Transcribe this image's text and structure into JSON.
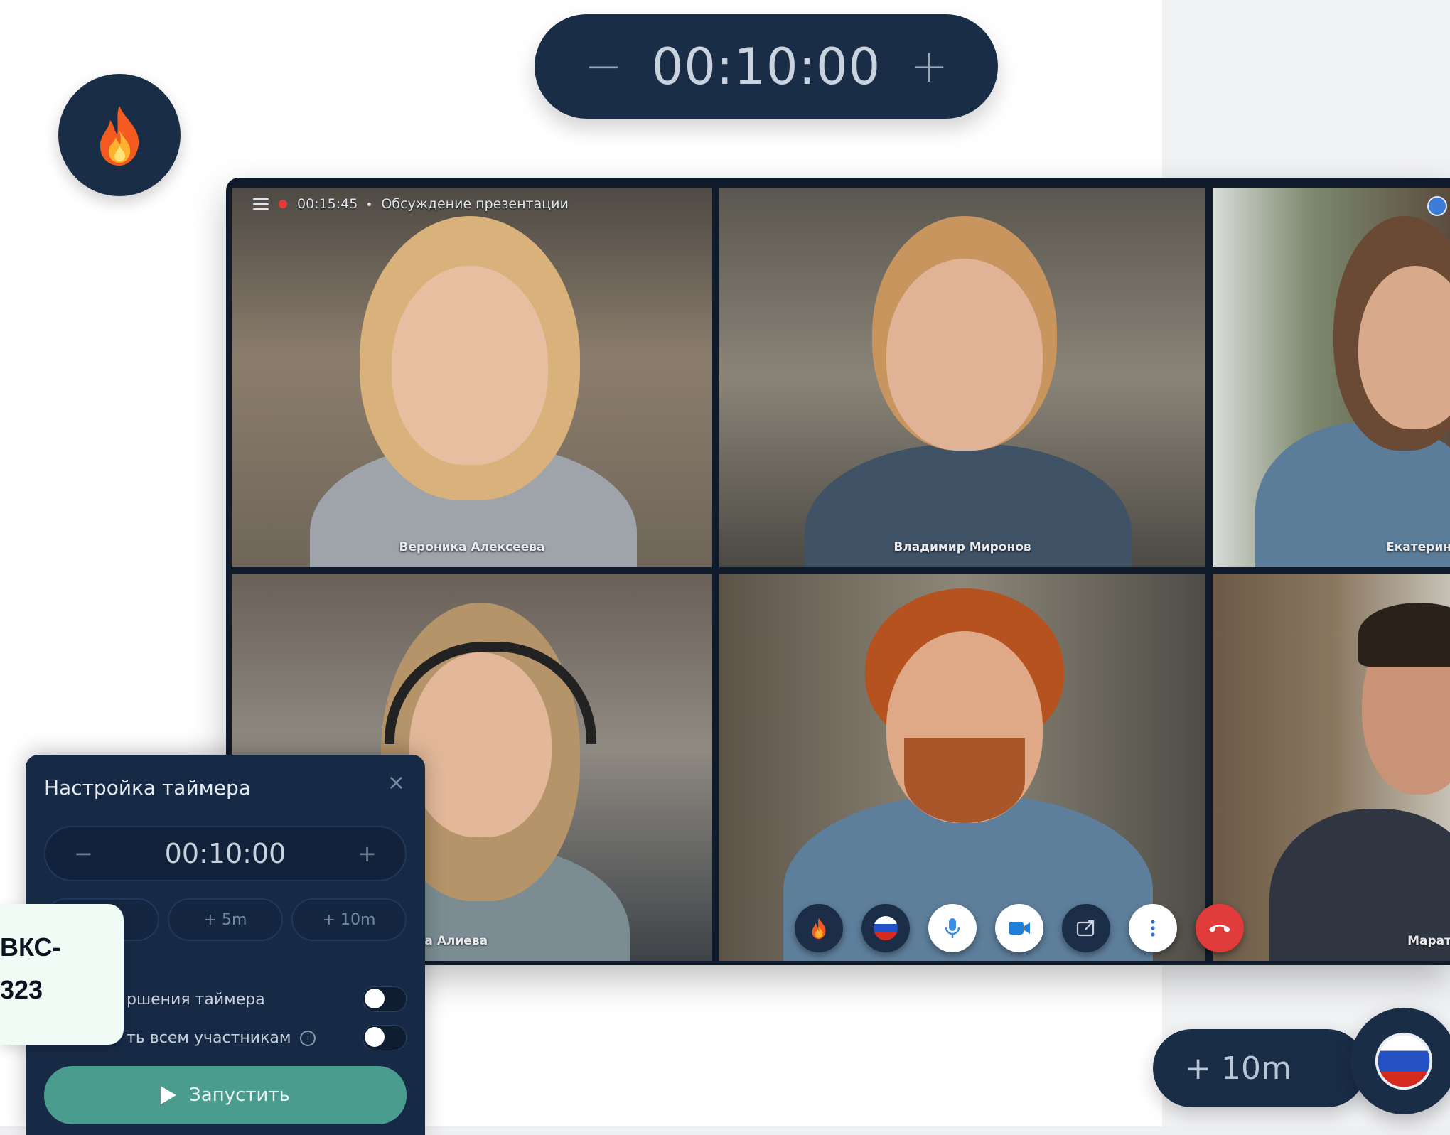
{
  "top_timer": {
    "minus": "−",
    "time": "00:10:00",
    "plus": "+"
  },
  "conference": {
    "elapsed": "00:15:45",
    "meeting_title": "Обсуждение презентации",
    "participants": [
      {
        "name": "Вероника Алексеева"
      },
      {
        "name": "Владимир Миронов"
      },
      {
        "name": "Екатерин"
      },
      {
        "name": "ета Алиева"
      },
      {
        "name": ""
      },
      {
        "name": "Марат"
      }
    ],
    "controls": [
      "fire-icon",
      "flag-icon",
      "microphone-icon",
      "camera-icon",
      "share-screen-icon",
      "more-icon",
      "hang-up-icon"
    ]
  },
  "timer_panel": {
    "title": "Настройка таймера",
    "close": "×",
    "minus": "−",
    "time": "00:10:00",
    "plus": "+",
    "quick_buttons": [
      "",
      "+ 5m",
      "+ 10m"
    ],
    "toggles": [
      {
        "label": "ршения таймера"
      },
      {
        "label": "ть всем участникам"
      }
    ],
    "info": "i",
    "start_label": "Запустить"
  },
  "callout": {
    "line1": "ВКС-",
    "line2": "323"
  },
  "plus_ten": {
    "label": "+ 10m"
  }
}
